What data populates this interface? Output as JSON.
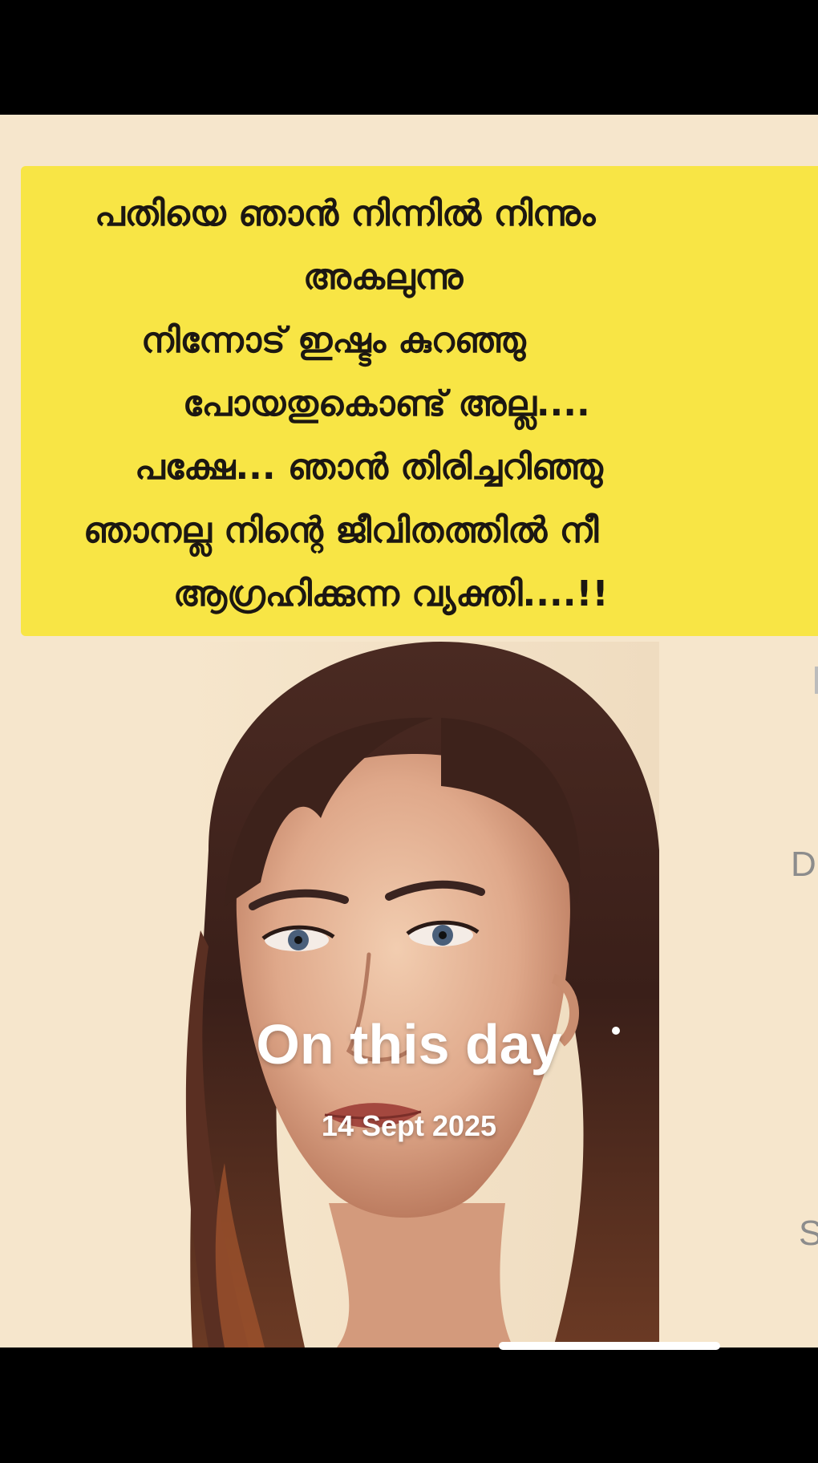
{
  "memory": {
    "overlay_title": "On this day",
    "overlay_date": "14 Sept 2025"
  },
  "quote": {
    "lines": [
      "പതിയെ ഞാൻ നിന്നിൽ നിന്നും",
      "അകലുന്നു",
      "നിന്നോട് ഇഷ്ടം കുറഞ്ഞു",
      "പോയതുകൊണ്ട് അല്ല....",
      "പക്ഷേ... ഞാൻ തിരിച്ചറിഞ്ഞു",
      "ഞാനല്ല നിന്റെ ജീവിതത്തിൽ നീ",
      "ആഗ്രഹിക്കുന്ന വ്യക്തി....!!"
    ]
  },
  "next_card_peek": {
    "letters": [
      "D",
      "S"
    ]
  },
  "colors": {
    "quote_background": "#f8e545",
    "card_background": "#f6e6cc",
    "quote_text": "#1c1712",
    "overlay_text": "#ffffff"
  }
}
